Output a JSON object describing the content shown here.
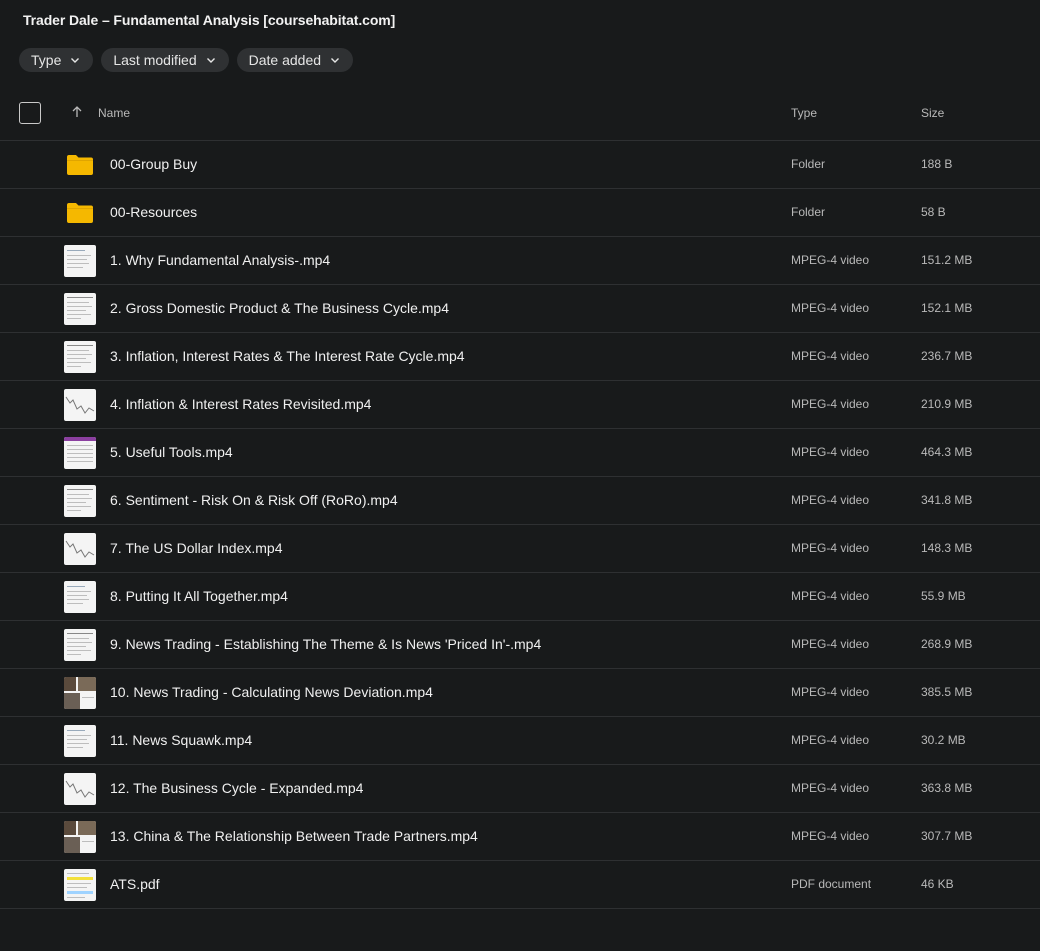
{
  "title": "Trader Dale – Fundamental Analysis [coursehabitat.com]",
  "filters": [
    {
      "label": "Type"
    },
    {
      "label": "Last modified"
    },
    {
      "label": "Date added"
    }
  ],
  "columns": {
    "name": "Name",
    "type": "Type",
    "size": "Size"
  },
  "files": [
    {
      "name": "00-Group Buy",
      "type": "Folder",
      "size": "188 B",
      "icon": "folder-icon"
    },
    {
      "name": "00-Resources",
      "type": "Folder",
      "size": "58 B",
      "icon": "folder-icon"
    },
    {
      "name": "1. Why Fundamental Analysis-.mp4",
      "type": "MPEG-4 video",
      "size": "151.2 MB",
      "icon": "video-thumbnail"
    },
    {
      "name": "2. Gross Domestic Product & The Business Cycle.mp4",
      "type": "MPEG-4 video",
      "size": "152.1 MB",
      "icon": "video-thumbnail"
    },
    {
      "name": "3. Inflation, Interest Rates & The Interest Rate Cycle.mp4",
      "type": "MPEG-4 video",
      "size": "236.7 MB",
      "icon": "video-thumbnail"
    },
    {
      "name": "4. Inflation & Interest Rates Revisited.mp4",
      "type": "MPEG-4 video",
      "size": "210.9 MB",
      "icon": "video-thumbnail"
    },
    {
      "name": "5. Useful Tools.mp4",
      "type": "MPEG-4 video",
      "size": "464.3 MB",
      "icon": "video-thumbnail"
    },
    {
      "name": "6. Sentiment - Risk On & Risk Off (RoRo).mp4",
      "type": "MPEG-4 video",
      "size": "341.8 MB",
      "icon": "video-thumbnail"
    },
    {
      "name": "7. The US Dollar Index.mp4",
      "type": "MPEG-4 video",
      "size": "148.3 MB",
      "icon": "video-thumbnail"
    },
    {
      "name": "8. Putting It All Together.mp4",
      "type": "MPEG-4 video",
      "size": "55.9 MB",
      "icon": "video-thumbnail"
    },
    {
      "name": "9. News Trading - Establishing The Theme & Is News 'Priced In'-.mp4",
      "type": "MPEG-4 video",
      "size": "268.9 MB",
      "icon": "video-thumbnail"
    },
    {
      "name": "10. News Trading - Calculating News Deviation.mp4",
      "type": "MPEG-4 video",
      "size": "385.5 MB",
      "icon": "video-thumbnail"
    },
    {
      "name": "11. News Squawk.mp4",
      "type": "MPEG-4 video",
      "size": "30.2 MB",
      "icon": "video-thumbnail"
    },
    {
      "name": "12. The Business Cycle - Expanded.mp4",
      "type": "MPEG-4 video",
      "size": "363.8 MB",
      "icon": "video-thumbnail"
    },
    {
      "name": "13. China & The Relationship Between Trade Partners.mp4",
      "type": "MPEG-4 video",
      "size": "307.7 MB",
      "icon": "video-thumbnail"
    },
    {
      "name": "ATS.pdf",
      "type": "PDF document",
      "size": "46 KB",
      "icon": "pdf-thumbnail"
    }
  ],
  "colors": {
    "background": "#181a1b",
    "folder": "#f5b800",
    "chip": "#2f3133",
    "divider": "#2e3032"
  }
}
